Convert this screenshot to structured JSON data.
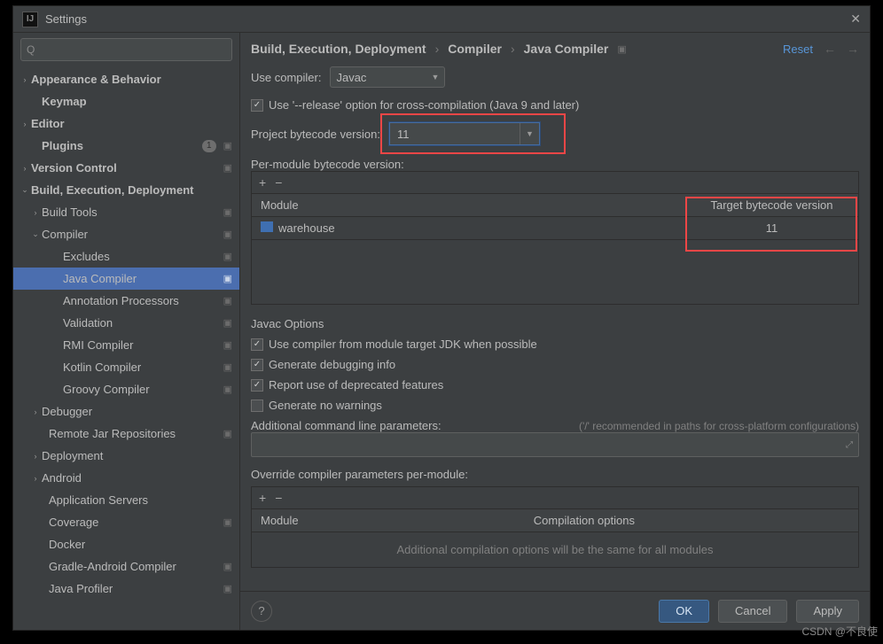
{
  "titlebar": {
    "title": "Settings"
  },
  "search": {
    "placeholder": ""
  },
  "tree": {
    "appearance": "Appearance & Behavior",
    "keymap": "Keymap",
    "editor": "Editor",
    "plugins": "Plugins",
    "plugins_badge": "1",
    "version_control": "Version Control",
    "bed": "Build, Execution, Deployment",
    "build_tools": "Build Tools",
    "compiler": "Compiler",
    "excludes": "Excludes",
    "java_compiler": "Java Compiler",
    "annotation": "Annotation Processors",
    "validation": "Validation",
    "rmi": "RMI Compiler",
    "kotlin": "Kotlin Compiler",
    "groovy": "Groovy Compiler",
    "debugger": "Debugger",
    "remote_jar": "Remote Jar Repositories",
    "deployment": "Deployment",
    "android": "Android",
    "app_servers": "Application Servers",
    "coverage": "Coverage",
    "docker": "Docker",
    "gradle_android": "Gradle-Android Compiler",
    "java_profiler": "Java Profiler"
  },
  "breadcrumbs": {
    "a": "Build, Execution, Deployment",
    "b": "Compiler",
    "c": "Java Compiler"
  },
  "reset": "Reset",
  "use_compiler_label": "Use compiler:",
  "use_compiler_value": "Javac",
  "release_option": "Use '--release' option for cross-compilation (Java 9 and later)",
  "pbv_label": "Project bytecode version:",
  "pbv_value": "11",
  "pmbv_label": "Per-module bytecode version:",
  "module_header": "Module",
  "target_header": "Target bytecode version",
  "module_row": {
    "name": "warehouse",
    "target": "11"
  },
  "javac_options_title": "Javac Options",
  "opt_target_jdk": "Use compiler from module target JDK when possible",
  "opt_debug": "Generate debugging info",
  "opt_deprecated": "Report use of deprecated features",
  "opt_nowarn": "Generate no warnings",
  "addl_params_label": "Additional command line parameters:",
  "addl_params_hint": "('/' recommended in paths for cross-platform configurations)",
  "override_label": "Override compiler parameters per-module:",
  "override_module": "Module",
  "override_opts": "Compilation options",
  "override_note": "Additional compilation options will be the same for all modules",
  "footer": {
    "ok": "OK",
    "cancel": "Cancel",
    "apply": "Apply"
  },
  "watermark": "CSDN @不良使"
}
